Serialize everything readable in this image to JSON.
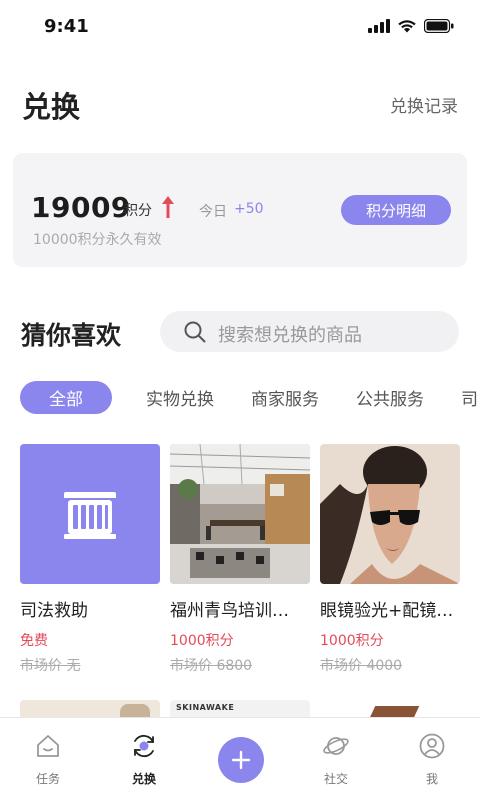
{
  "status": {
    "time": "9:41"
  },
  "header": {
    "title": "兑换",
    "record_link": "兑换记录"
  },
  "points": {
    "value": "19009",
    "unit": "积分",
    "today_label": "今日",
    "today_value": "+50",
    "note": "10000积分永久有效",
    "detail_button": "积分明细"
  },
  "section": {
    "title": "猜你喜欢"
  },
  "search": {
    "placeholder": "搜索想兑换的商品"
  },
  "tabs": [
    "全部",
    "实物兑换",
    "商家服务",
    "公共服务",
    "司"
  ],
  "products": [
    {
      "name": "司法救助",
      "price": "免费",
      "market": "市场价 无",
      "icon": "building-icon"
    },
    {
      "name": "福州青鸟培训…",
      "price": "1000积分",
      "market": "市场价 6800",
      "icon": "office-photo"
    },
    {
      "name": "眼镜验光+配镜…",
      "price": "1000积分",
      "market": "市场价 4000",
      "icon": "sunglasses-photo"
    }
  ],
  "row2_brand": "SKINAWAKE",
  "nav": [
    "任务",
    "兑换",
    "社交",
    "我"
  ],
  "colors": {
    "accent": "#8a86ed",
    "price": "#e24b5c"
  }
}
